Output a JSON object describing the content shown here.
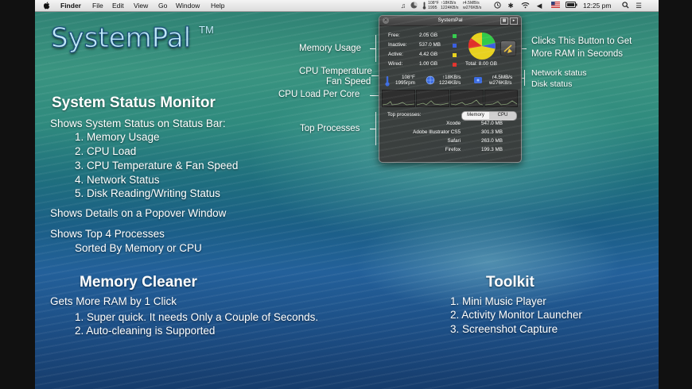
{
  "menubar": {
    "apple": "",
    "app": "Finder",
    "menus": [
      "File",
      "Edit",
      "View",
      "Go",
      "Window",
      "Help"
    ],
    "net_top": "↑18KB/s",
    "net_bottom": "1224KB/s",
    "disk_top": "r4.5MB/s",
    "disk_bottom": "w276KB/s",
    "cpu_mini": "1995",
    "clock": "12:25 pm"
  },
  "logo": {
    "name": "SystemPal",
    "tm": "TM"
  },
  "status_monitor": {
    "heading": "System Status Monitor",
    "intro": "Shows System Status on Status Bar:",
    "items": [
      "1. Memory Usage",
      "2. CPU Load",
      "3. CPU Temperature & Fan Speed",
      "4. Network Status",
      "5. Disk Reading/Writing Status"
    ],
    "details": "Shows Details on a Popover Window",
    "top4": "Shows Top 4 Processes",
    "sorted": "Sorted By Memory or CPU"
  },
  "memory_cleaner": {
    "heading": "Memory Cleaner",
    "intro": "Gets More RAM by 1 Click",
    "items": [
      "1. Super quick. It needs Only a Couple of Seconds.",
      "2. Auto-cleaning is Supported"
    ]
  },
  "toolkit": {
    "heading": "Toolkit",
    "items": [
      "1. Mini Music Player",
      "2. Activity Monitor Launcher",
      "3. Screenshot Capture"
    ]
  },
  "annotations": {
    "memory_usage": "Memory Usage",
    "cpu_temp": "CPU Temperature",
    "fan_speed": "Fan Speed",
    "cpu_load": "CPU Load Per Core",
    "top_processes": "Top Processes",
    "clean_button_1": "Clicks This Button to Get",
    "clean_button_2": "More RAM in Seconds",
    "network": "Network status",
    "disk": "Disk status"
  },
  "popover": {
    "title": "SystemPal",
    "memory": [
      {
        "label": "Free:",
        "value": "2.05 GB",
        "color": "#31c94a"
      },
      {
        "label": "Inactive:",
        "value": "537.0 MB",
        "color": "#3b5fe0"
      },
      {
        "label": "Active:",
        "value": "4.42 GB",
        "color": "#e8d21f"
      },
      {
        "label": "Wired:",
        "value": "1.00 GB",
        "color": "#e0302a"
      }
    ],
    "total": "Total:  8.00 GB",
    "temp": "108°F",
    "fan": "1995rpm",
    "net_up": "↑18KB/s",
    "net_down": "1224KB/s",
    "disk_read": "r4.5MB/s",
    "disk_write": "w276KB/s",
    "top_label": "Top processes:",
    "sort_memory": "Memory",
    "sort_cpu": "CPU",
    "processes": [
      {
        "name": "Xcode",
        "value": "547.0 MB"
      },
      {
        "name": "Adobe Illustrator CS5",
        "value": "301.3 MB"
      },
      {
        "name": "Safari",
        "value": "263.0 MB"
      },
      {
        "name": "Firefox",
        "value": "199.3 MB"
      }
    ]
  }
}
